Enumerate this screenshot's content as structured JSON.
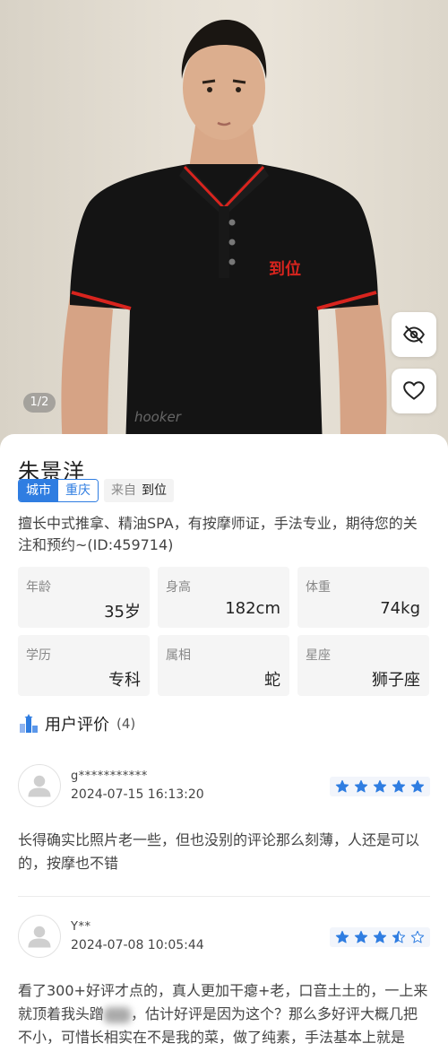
{
  "hero": {
    "image_counter": "1/2",
    "shirt_logo": "到位",
    "watermark": "hooker",
    "hide_button_icon": "eye-off-icon",
    "favorite_button_icon": "heart-icon"
  },
  "profile": {
    "name": "朱景洋",
    "city_tag": {
      "key": "城市",
      "value": "重庆"
    },
    "source_tag": {
      "key": "来自",
      "value": "到位"
    },
    "bio": "擅长中式推拿、精油SPA，有按摩师证，手法专业，期待您的关注和预约~(ID:459714)",
    "stats": [
      {
        "label": "年龄",
        "value": "35岁"
      },
      {
        "label": "身高",
        "value": "182cm"
      },
      {
        "label": "体重",
        "value": "74kg"
      },
      {
        "label": "学历",
        "value": "专科"
      },
      {
        "label": "属相",
        "value": "蛇"
      },
      {
        "label": "星座",
        "value": "狮子座"
      }
    ]
  },
  "reviews": {
    "title": "用户评价",
    "count": "(4)",
    "items": [
      {
        "user": "g***********",
        "time": "2024-07-15 16:13:20",
        "rating": 5,
        "text": "长得确实比照片老一些，但也没别的评论那么刻薄，人还是可以的，按摩也不错"
      },
      {
        "user": "Y**",
        "time": "2024-07-08 10:05:44",
        "rating": 3.5,
        "text_a": "看了300+好评才点的，真人更加干瘪+老，口音土土的，一上来就顶着我头蹭",
        "text_b": "，估计好评是因为这个？那么多好评大概几把不小，可惜长相实在不是我的菜，做了纯素，手法基本上就是推，如果健身以后不太能解否，不过"
      }
    ]
  },
  "colors": {
    "accent": "#2f7de1",
    "shirt_red": "#d8241e"
  }
}
